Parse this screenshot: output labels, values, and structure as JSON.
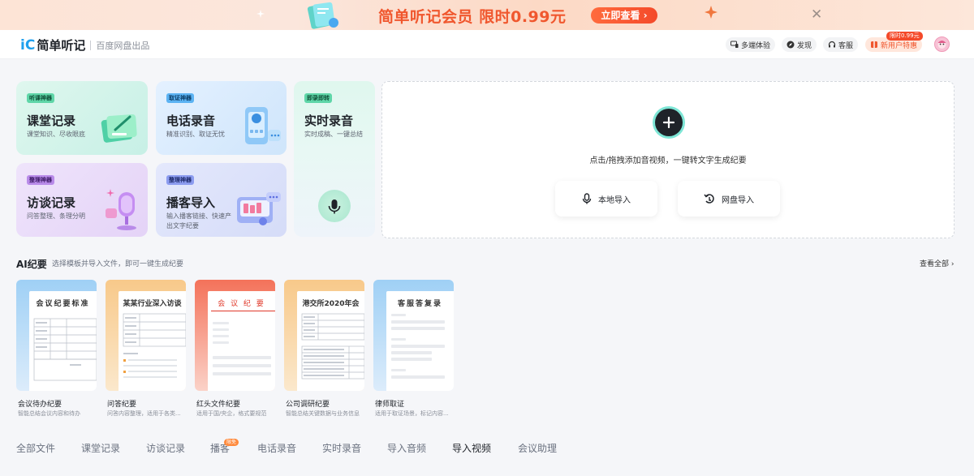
{
  "banner": {
    "promo_text": "简单听记会员 限时0.99元",
    "cta_label": "立即查看",
    "close_label": "✕",
    "colors": {
      "accent": "#f0572e",
      "button": "#f44a2a"
    }
  },
  "header": {
    "logo_mark": "iC",
    "app_name": "简单听记",
    "subtitle": "百度网盘出品",
    "buttons": {
      "multi_device": "多端体验",
      "feedback": "发现",
      "service": "客服",
      "new_user": "新用户特惠"
    },
    "promo_tag": "限时0.99元"
  },
  "features": [
    {
      "tag": "听课神器",
      "title": "课堂记录",
      "desc": "课堂知识、尽收眼底",
      "icon": "notebook-icon"
    },
    {
      "tag": "取证神器",
      "title": "电话录音",
      "desc": "精准识别、取证无忧",
      "icon": "phone-icon"
    },
    {
      "tag": "即录即转",
      "title": "实时录音",
      "desc": "实时成稿、一键总结",
      "icon": "microphone-icon"
    },
    {
      "tag": "整理神器",
      "title": "访谈记录",
      "desc": "问答整理、条理分明",
      "icon": "mic-stand-icon"
    },
    {
      "tag": "整理神器",
      "title": "播客导入",
      "desc": "输入播客链接、快速产出文字纪要",
      "icon": "podcast-icon"
    }
  ],
  "upload": {
    "hint": "点击/拖拽添加音视频，一键转文字生成纪要",
    "local_import": "本地导入",
    "cloud_import": "网盘导入"
  },
  "ai": {
    "title": "AI纪要",
    "subtitle": "选择模板并导入文件，即可一键生成纪要",
    "view_all": "查看全部 ›"
  },
  "templates": [
    {
      "paper_title": "会议纪要标准",
      "name": "会议待办纪要",
      "desc": "智能总结会议内容和待办"
    },
    {
      "paper_title": "某某行业深入访谈",
      "name": "问答纪要",
      "desc": "问答内容整理，适用于各类..."
    },
    {
      "paper_title": "会 议 纪 要",
      "name": "红头文件纪要",
      "desc": "适用于国/央企，格式要规范"
    },
    {
      "paper_title": "港交所2020年会",
      "name": "公司调研纪要",
      "desc": "智能总结关键数据与业务信息"
    },
    {
      "paper_title": "客服答复录",
      "name": "律师取证",
      "desc": "适用于取证场景，标记内容..."
    }
  ],
  "tabs": [
    {
      "label": "全部文件"
    },
    {
      "label": "课堂记录"
    },
    {
      "label": "访谈记录"
    },
    {
      "label": "播客"
    },
    {
      "label": "电话录音"
    },
    {
      "label": "实时录音"
    },
    {
      "label": "导入音频"
    },
    {
      "label": "导入视频",
      "active": true
    },
    {
      "label": "会议助理"
    }
  ],
  "tab_badge": "限免"
}
